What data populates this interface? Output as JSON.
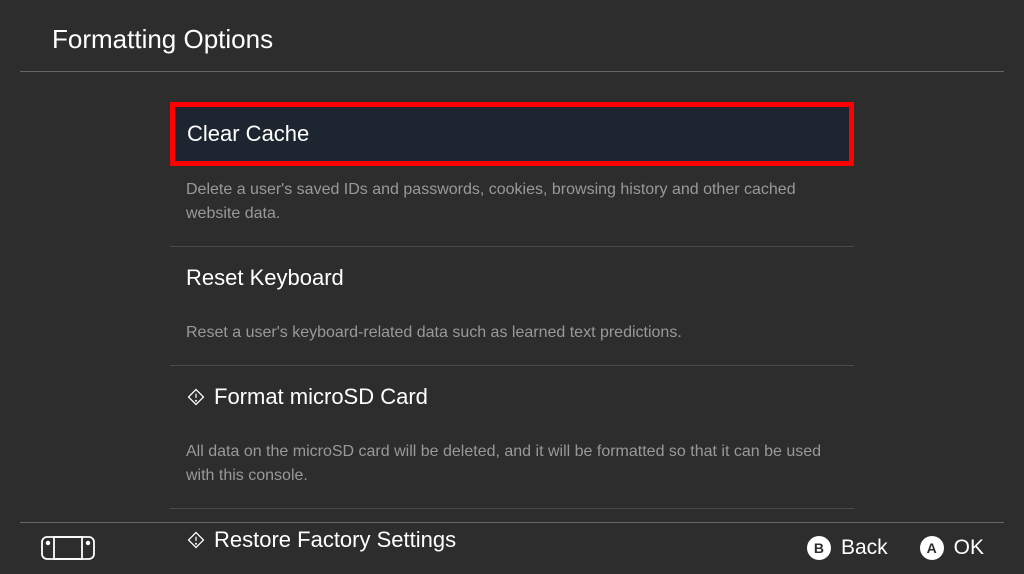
{
  "header": {
    "title": "Formatting Options"
  },
  "options": [
    {
      "title": "Clear Cache",
      "description": "Delete a user's saved IDs and passwords, cookies, browsing history and other cached website data.",
      "highlighted": true,
      "hasWarning": false
    },
    {
      "title": "Reset Keyboard",
      "description": "Reset a user's keyboard-related data such as learned text predictions.",
      "highlighted": false,
      "hasWarning": false
    },
    {
      "title": "Format microSD Card",
      "description": "All data on the microSD card will be deleted, and it will be formatted so that it can be used with this console.",
      "highlighted": false,
      "hasWarning": true
    },
    {
      "title": "Restore Factory Settings",
      "description": "",
      "highlighted": false,
      "hasWarning": true
    }
  ],
  "footer": {
    "back": {
      "letter": "B",
      "label": "Back"
    },
    "ok": {
      "letter": "A",
      "label": "OK"
    }
  }
}
